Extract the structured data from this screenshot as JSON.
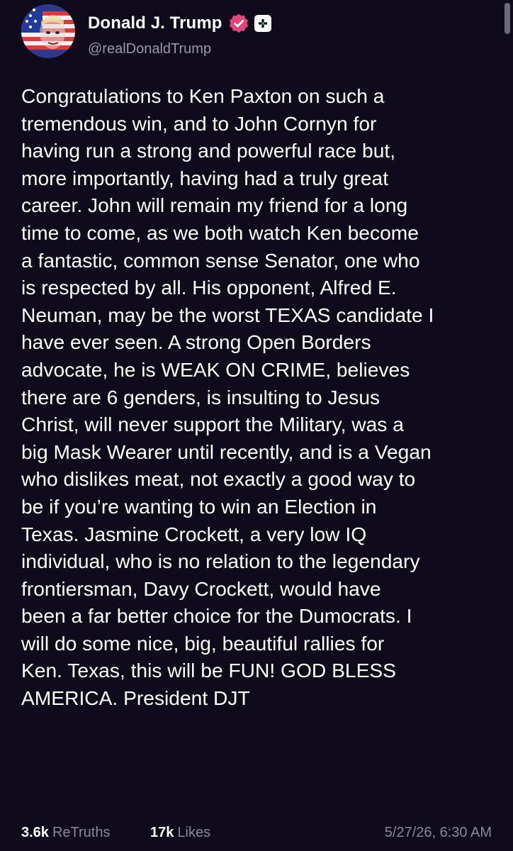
{
  "author": {
    "display_name": "Donald J. Trump",
    "handle": "@realDonaldTrump",
    "verified_icon": "verified-badge-icon",
    "verified_color": "#e0457b",
    "plus_icon": "plus-badge-icon"
  },
  "post": {
    "lines": [
      "Congratulations to Ken Paxton on such a",
      "tremendous win, and to John Cornyn for",
      "having run a strong and powerful race but,",
      "more importantly, having had a truly great",
      "career. John will remain my friend for a long",
      "time to come, as we both watch Ken become",
      "a fantastic, common sense Senator, one who",
      "is respected by all. His opponent, Alfred E.",
      "Neuman, may be the worst TEXAS candidate I",
      "have ever seen. A strong Open Borders",
      "advocate, he is WEAK ON CRIME, believes",
      "there are 6 genders, is insulting to Jesus",
      "Christ, will never support the Military, was a",
      "big Mask Wearer until recently, and is a Vegan",
      "who dislikes meat, not exactly a good way to",
      "be if you’re wanting to win an Election in",
      "Texas. Jasmine Crockett, a very low IQ",
      "individual, who is no relation to the legendary",
      "frontiersman, Davy Crockett, would have",
      "been a far better choice for the Dumocrats. I",
      "will do some nice, big, beautiful rallies for",
      "Ken. Texas, this will be FUN! GOD BLESS",
      "AMERICA. President DJT"
    ]
  },
  "footer": {
    "retruths_count": "3.6k",
    "retruths_label": "ReTruths",
    "likes_count": "17k",
    "likes_label": "Likes",
    "timestamp": "5/27/26, 6:30 AM"
  },
  "colors": {
    "background": "#0f0b1a",
    "text": "#ffffff",
    "muted": "#8b8896"
  }
}
